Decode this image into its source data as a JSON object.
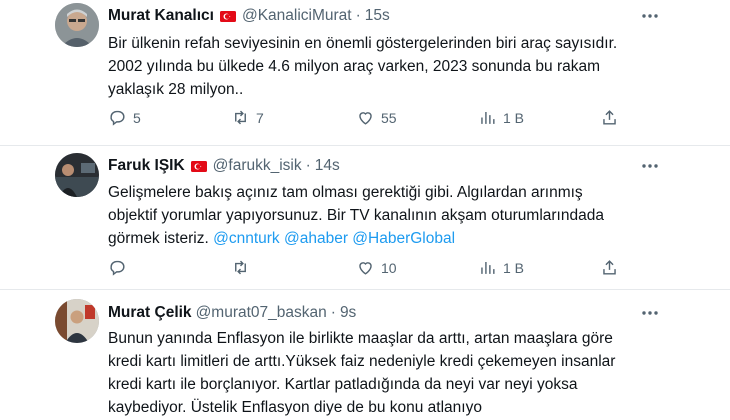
{
  "tweets": [
    {
      "name": "Murat Kanalıcı",
      "handle": "@KanaliciMurat",
      "dot": "·",
      "time": "15s",
      "lines": [
        "Bir ülkenin refah seviyesinin en önemli göstergelerinden biri araç sayısıdır.",
        "2002 yılında bu ülkede 4.6 milyon araç varken, 2023 sonunda bu rakam",
        "yaklaşık 28 milyon.."
      ],
      "replies": "5",
      "reposts": "7",
      "likes": "55",
      "views": "1 B"
    },
    {
      "name": "Faruk IŞIK",
      "handle": "@farukk_isik",
      "dot": "·",
      "time": "14s",
      "lines": [
        "Gelişmelere bakış açınız tam olması gerektiği gibi. Algılardan arınmış",
        "objektif yorumlar yapıyorsunuz. Bir TV kanalının akşam oturumlarındada"
      ],
      "line3_prefix": "görmek isteriz. ",
      "mentions": [
        "@cnnturk",
        "@ahaber",
        "@HaberGlobal"
      ],
      "replies": "",
      "reposts": "",
      "likes": "10",
      "views": "1 B"
    },
    {
      "name": "Murat Çelik",
      "handle": "@murat07_baskan",
      "dot": "·",
      "time": "9s",
      "lines": [
        "Bunun yanında Enflasyon ile birlikte maaşlar da arttı, artan maaşlara göre",
        "kredi kartı limitleri de arttı.Yüksek faiz nedeniyle kredi çekemeyen insanlar",
        "kredi kartı ile borçlanıyor. Kartlar patladığında da neyi var neyi yoksa",
        "kaybediyor. Üstelik Enflasyon diye de bu konu atlanıyo"
      ]
    }
  ],
  "colors": {
    "accent": "#1d9bf0",
    "muted": "#536471",
    "flag": "#e30a17"
  },
  "icons": [
    "reply-icon",
    "repost-icon",
    "like-icon",
    "views-icon",
    "share-icon",
    "more-icon",
    "turkey-flag-icon"
  ]
}
